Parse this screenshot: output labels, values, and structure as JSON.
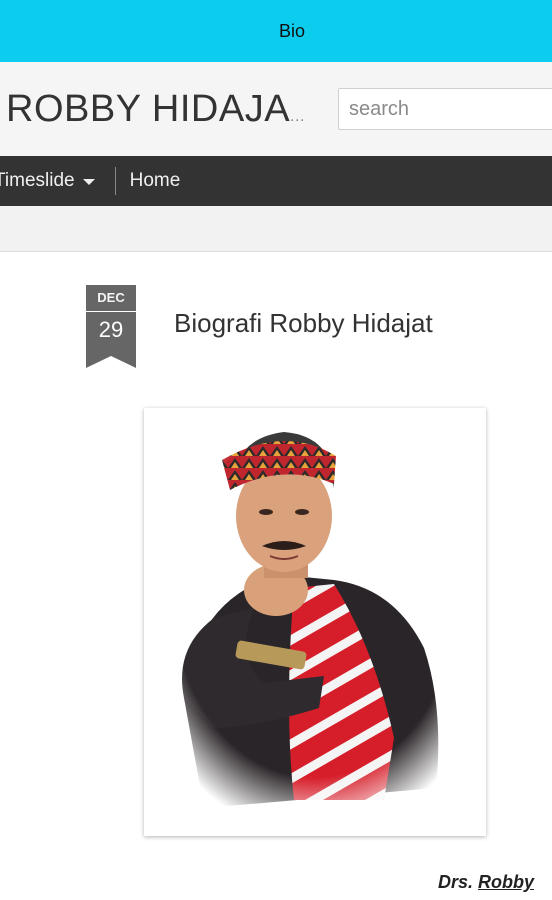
{
  "topbar": {
    "title": "Bio"
  },
  "header": {
    "blog_title": "ROBBY HIDAJA",
    "title_ellipsis": "...",
    "search_placeholder": "search"
  },
  "nav": {
    "items": [
      {
        "label": "Timeslide",
        "has_dropdown": true
      },
      {
        "label": "Home"
      }
    ]
  },
  "post": {
    "date": {
      "month": "DEC",
      "day": "29"
    },
    "title": "Biografi Robby Hidajat",
    "image_icon": "portrait-photo",
    "byline_prefix": "Drs.",
    "byline_link": "Robby"
  },
  "colors": {
    "topbar": "#0dcdef",
    "nav_bg": "#333333",
    "date_badge": "#666666"
  }
}
